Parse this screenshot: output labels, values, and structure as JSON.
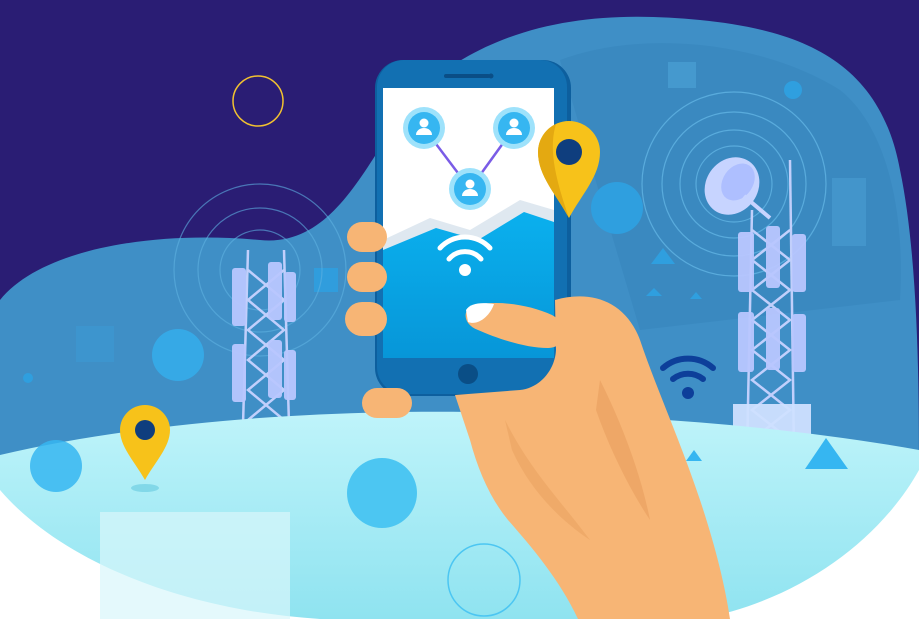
{
  "scene": {
    "icons": {
      "phone": "smartphone-icon",
      "wifi": "wifi-icon",
      "location": "location-pin-icon",
      "user": "user-icon",
      "tower": "cell-tower-icon",
      "dish": "satellite-dish-icon"
    },
    "colors": {
      "night_sky": "#2a1d74",
      "blob": "#3f8fc6",
      "ground": "#aeeef6",
      "phone_body": "#0f69a8",
      "phone_screen": "#0aa7e6",
      "pin": "#f7c21a",
      "skin": "#f7b575",
      "wifi_dark": "#0d3f9a",
      "tower": "#b9c7ff",
      "node": "#36b6f1"
    }
  }
}
